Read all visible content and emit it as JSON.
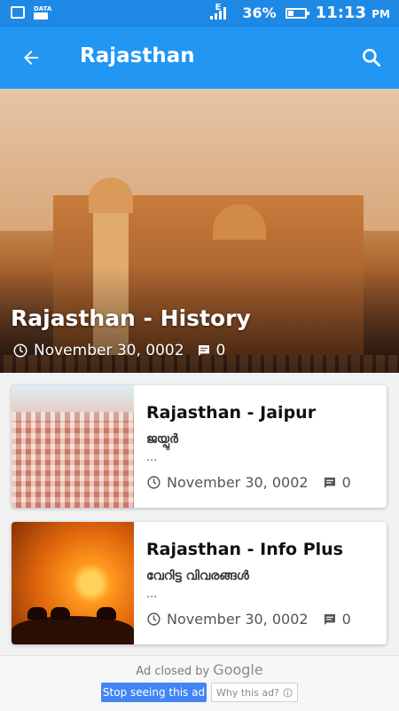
{
  "status_bar": {
    "data_label": "DATA",
    "network_label": "E",
    "battery": "36%",
    "battery_level": 0.36,
    "time": "11:13",
    "ampm": "PM"
  },
  "app_bar": {
    "title": "Rajasthan",
    "back_icon": "arrow-back-icon",
    "search_icon": "search-icon",
    "color": "#2196f3"
  },
  "hero": {
    "title": "Rajasthan - History",
    "date": "November 30, 0002",
    "comments": "0",
    "clock_icon": "clock-icon",
    "comment_icon": "comment-icon"
  },
  "posts": [
    {
      "title": "Rajasthan - Jaipur",
      "subtitle": "ജയ്പുർ",
      "excerpt": "...",
      "date": "November 30, 0002",
      "comments": "0"
    },
    {
      "title": "Rajasthan - Info Plus",
      "subtitle": "വേറിട്ട വിവരങ്ങൾ",
      "excerpt": "...",
      "date": "November 30, 0002",
      "comments": "0"
    }
  ],
  "ad": {
    "closed_by": "Ad closed by",
    "brand": "Google",
    "stop_label": "Stop seeing this ad",
    "why_label": "Why this ad?"
  }
}
